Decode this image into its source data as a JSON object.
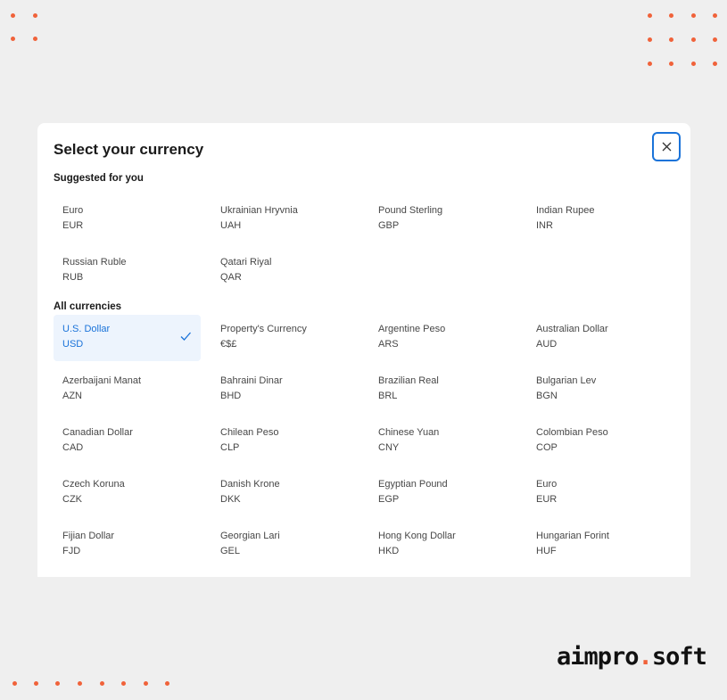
{
  "dialog": {
    "title": "Select your currency",
    "close_icon": "close-icon"
  },
  "suggested": {
    "label": "Suggested for you",
    "items": [
      {
        "name": "Euro",
        "code": "EUR"
      },
      {
        "name": "Ukrainian Hryvnia",
        "code": "UAH"
      },
      {
        "name": "Pound Sterling",
        "code": "GBP"
      },
      {
        "name": "Indian Rupee",
        "code": "INR"
      },
      {
        "name": "Russian Ruble",
        "code": "RUB"
      },
      {
        "name": "Qatari Riyal",
        "code": "QAR"
      }
    ]
  },
  "all": {
    "label": "All currencies",
    "selected_code": "USD",
    "items": [
      {
        "name": "U.S. Dollar",
        "code": "USD",
        "selected": true
      },
      {
        "name": "Property's Currency",
        "code": "€$£"
      },
      {
        "name": "Argentine Peso",
        "code": "ARS"
      },
      {
        "name": "Australian Dollar",
        "code": "AUD"
      },
      {
        "name": "Azerbaijani Manat",
        "code": "AZN"
      },
      {
        "name": "Bahraini Dinar",
        "code": "BHD"
      },
      {
        "name": "Brazilian Real",
        "code": "BRL"
      },
      {
        "name": "Bulgarian Lev",
        "code": "BGN"
      },
      {
        "name": "Canadian Dollar",
        "code": "CAD"
      },
      {
        "name": "Chilean Peso",
        "code": "CLP"
      },
      {
        "name": "Chinese Yuan",
        "code": "CNY"
      },
      {
        "name": "Colombian Peso",
        "code": "COP"
      },
      {
        "name": "Czech Koruna",
        "code": "CZK"
      },
      {
        "name": "Danish Krone",
        "code": "DKK"
      },
      {
        "name": "Egyptian Pound",
        "code": "EGP"
      },
      {
        "name": "Euro",
        "code": "EUR"
      },
      {
        "name": "Fijian Dollar",
        "code": "FJD"
      },
      {
        "name": "Georgian Lari",
        "code": "GEL"
      },
      {
        "name": "Hong Kong Dollar",
        "code": "HKD"
      },
      {
        "name": "Hungarian Forint",
        "code": "HUF"
      }
    ]
  },
  "branding": {
    "logo_left": "aimpro",
    "logo_dot": ".",
    "logo_right": "soft"
  },
  "colors": {
    "accent": "#1a73d9",
    "selected_bg": "#edf4fd",
    "brand_orange": "#f0623a",
    "page_bg": "#efefef"
  }
}
